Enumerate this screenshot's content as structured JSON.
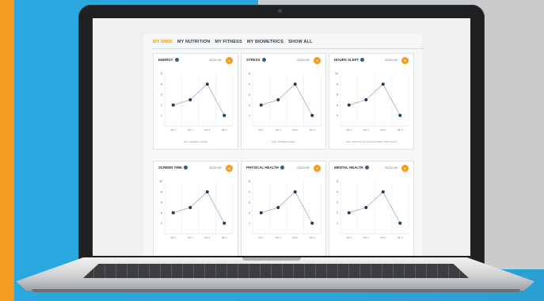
{
  "tabs": [
    "MY MIND",
    "MY NUTRITION",
    "MY FITNESS",
    "MY BIOMETRICS",
    "SHOW ALL"
  ],
  "active_tab": 0,
  "colors": {
    "accent": "#f39c1f",
    "point": "#1f3f5f",
    "line": "#9aa2aa",
    "grid": "#e5e7ea"
  },
  "icons": {
    "info": "info-icon",
    "baseline_badge": "baseline-badge"
  },
  "cards": [
    {
      "title": "ENERGY",
      "baseline_label": "BASELINE",
      "badge": "4",
      "caption": "AVG. ENERGY LEVEL"
    },
    {
      "title": "STRESS",
      "baseline_label": "BASELINE",
      "badge": "4",
      "caption": "AVG. STRESS LEVEL"
    },
    {
      "title": "HOURS SLEPT",
      "baseline_label": "BASELINE",
      "badge": "8",
      "caption": "AVG. AMOUNT OF HOURS SLEPT PER NIGHT"
    },
    {
      "title": "SCREEN TIME",
      "baseline_label": "BASELINE",
      "badge": "8",
      "caption": ""
    },
    {
      "title": "PHYSICAL HEALTH",
      "baseline_label": "BASELINE",
      "badge": "4",
      "caption": ""
    },
    {
      "title": "MENTAL HEALTH",
      "baseline_label": "BASELINE",
      "badge": "4",
      "caption": ""
    }
  ],
  "chart_data": [
    {
      "type": "line",
      "x": [
        "WK 1",
        "WK 2",
        "WK 3",
        "WK 4"
      ],
      "values": [
        2,
        2.5,
        4,
        1
      ],
      "ylim": [
        0,
        5
      ],
      "yticks": [
        1,
        2,
        3,
        4,
        5
      ]
    },
    {
      "type": "line",
      "x": [
        "WK 1",
        "WK 2",
        "WK 3",
        "WK 4"
      ],
      "values": [
        2,
        2.5,
        4,
        1
      ],
      "ylim": [
        0,
        5
      ],
      "yticks": [
        1,
        2,
        3,
        4,
        5
      ]
    },
    {
      "type": "line",
      "x": [
        "WK 1",
        "WK 2",
        "WK 3",
        "WK 4"
      ],
      "values": [
        4,
        5,
        8,
        2
      ],
      "ylim": [
        0,
        10
      ],
      "yticks": [
        2,
        4,
        6,
        8,
        10
      ]
    },
    {
      "type": "line",
      "x": [
        "WK 1",
        "WK 2",
        "WK 3",
        "WK 4"
      ],
      "values": [
        4,
        5,
        8,
        2
      ],
      "ylim": [
        0,
        10
      ],
      "yticks": [
        2,
        4,
        6,
        8,
        10
      ]
    },
    {
      "type": "line",
      "x": [
        "WK 1",
        "WK 2",
        "WK 3",
        "WK 4"
      ],
      "values": [
        2,
        2.5,
        4,
        1
      ],
      "ylim": [
        0,
        5
      ],
      "yticks": [
        1,
        2,
        3,
        4,
        5
      ]
    },
    {
      "type": "line",
      "x": [
        "WK 1",
        "WK 2",
        "WK 3",
        "WK 4"
      ],
      "values": [
        2,
        2.5,
        4,
        1
      ],
      "ylim": [
        0,
        5
      ],
      "yticks": [
        1,
        2,
        3,
        4,
        5
      ]
    }
  ]
}
